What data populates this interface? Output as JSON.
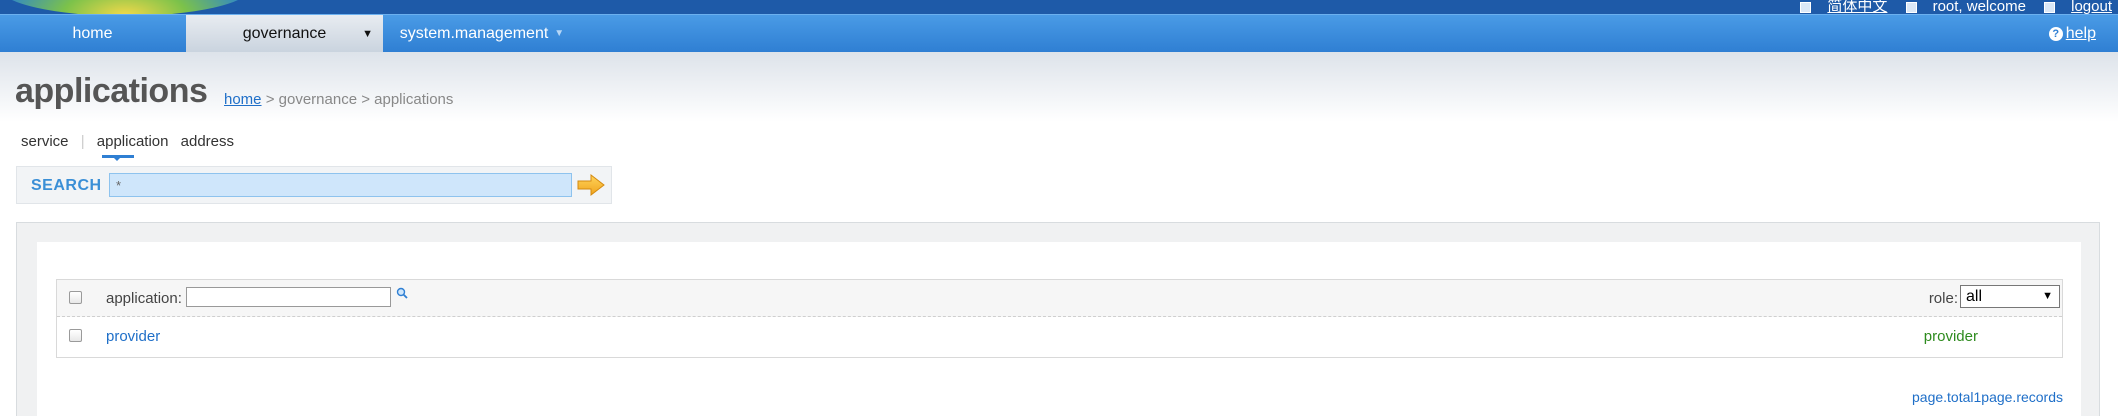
{
  "topbar": {
    "links": [
      "简体中文",
      "root, welcome",
      "logout"
    ]
  },
  "nav": {
    "home": "home",
    "governance": "governance",
    "system_management": "system.management",
    "help": "help"
  },
  "page": {
    "title": "applications",
    "breadcrumb": {
      "home": "home",
      "sep1": ">",
      "governance": "governance",
      "sep2": ">",
      "current": "applications"
    }
  },
  "subtabs": {
    "service": "service",
    "sep": "|",
    "application": "application",
    "address": "address"
  },
  "search": {
    "label": "SEARCH",
    "value": "*"
  },
  "grid": {
    "filter_label": "application:",
    "filter_value": "",
    "role_label": "role:",
    "role_selected": "all",
    "rows": [
      {
        "application": "provider",
        "role": "provider"
      }
    ]
  },
  "pager": {
    "text": "page.total1page.records"
  },
  "colors": {
    "nav_blue": "#2f7fd3",
    "link_blue": "#1f6fc8",
    "role_green": "#2e8b1e",
    "search_label": "#3b8fd6"
  }
}
